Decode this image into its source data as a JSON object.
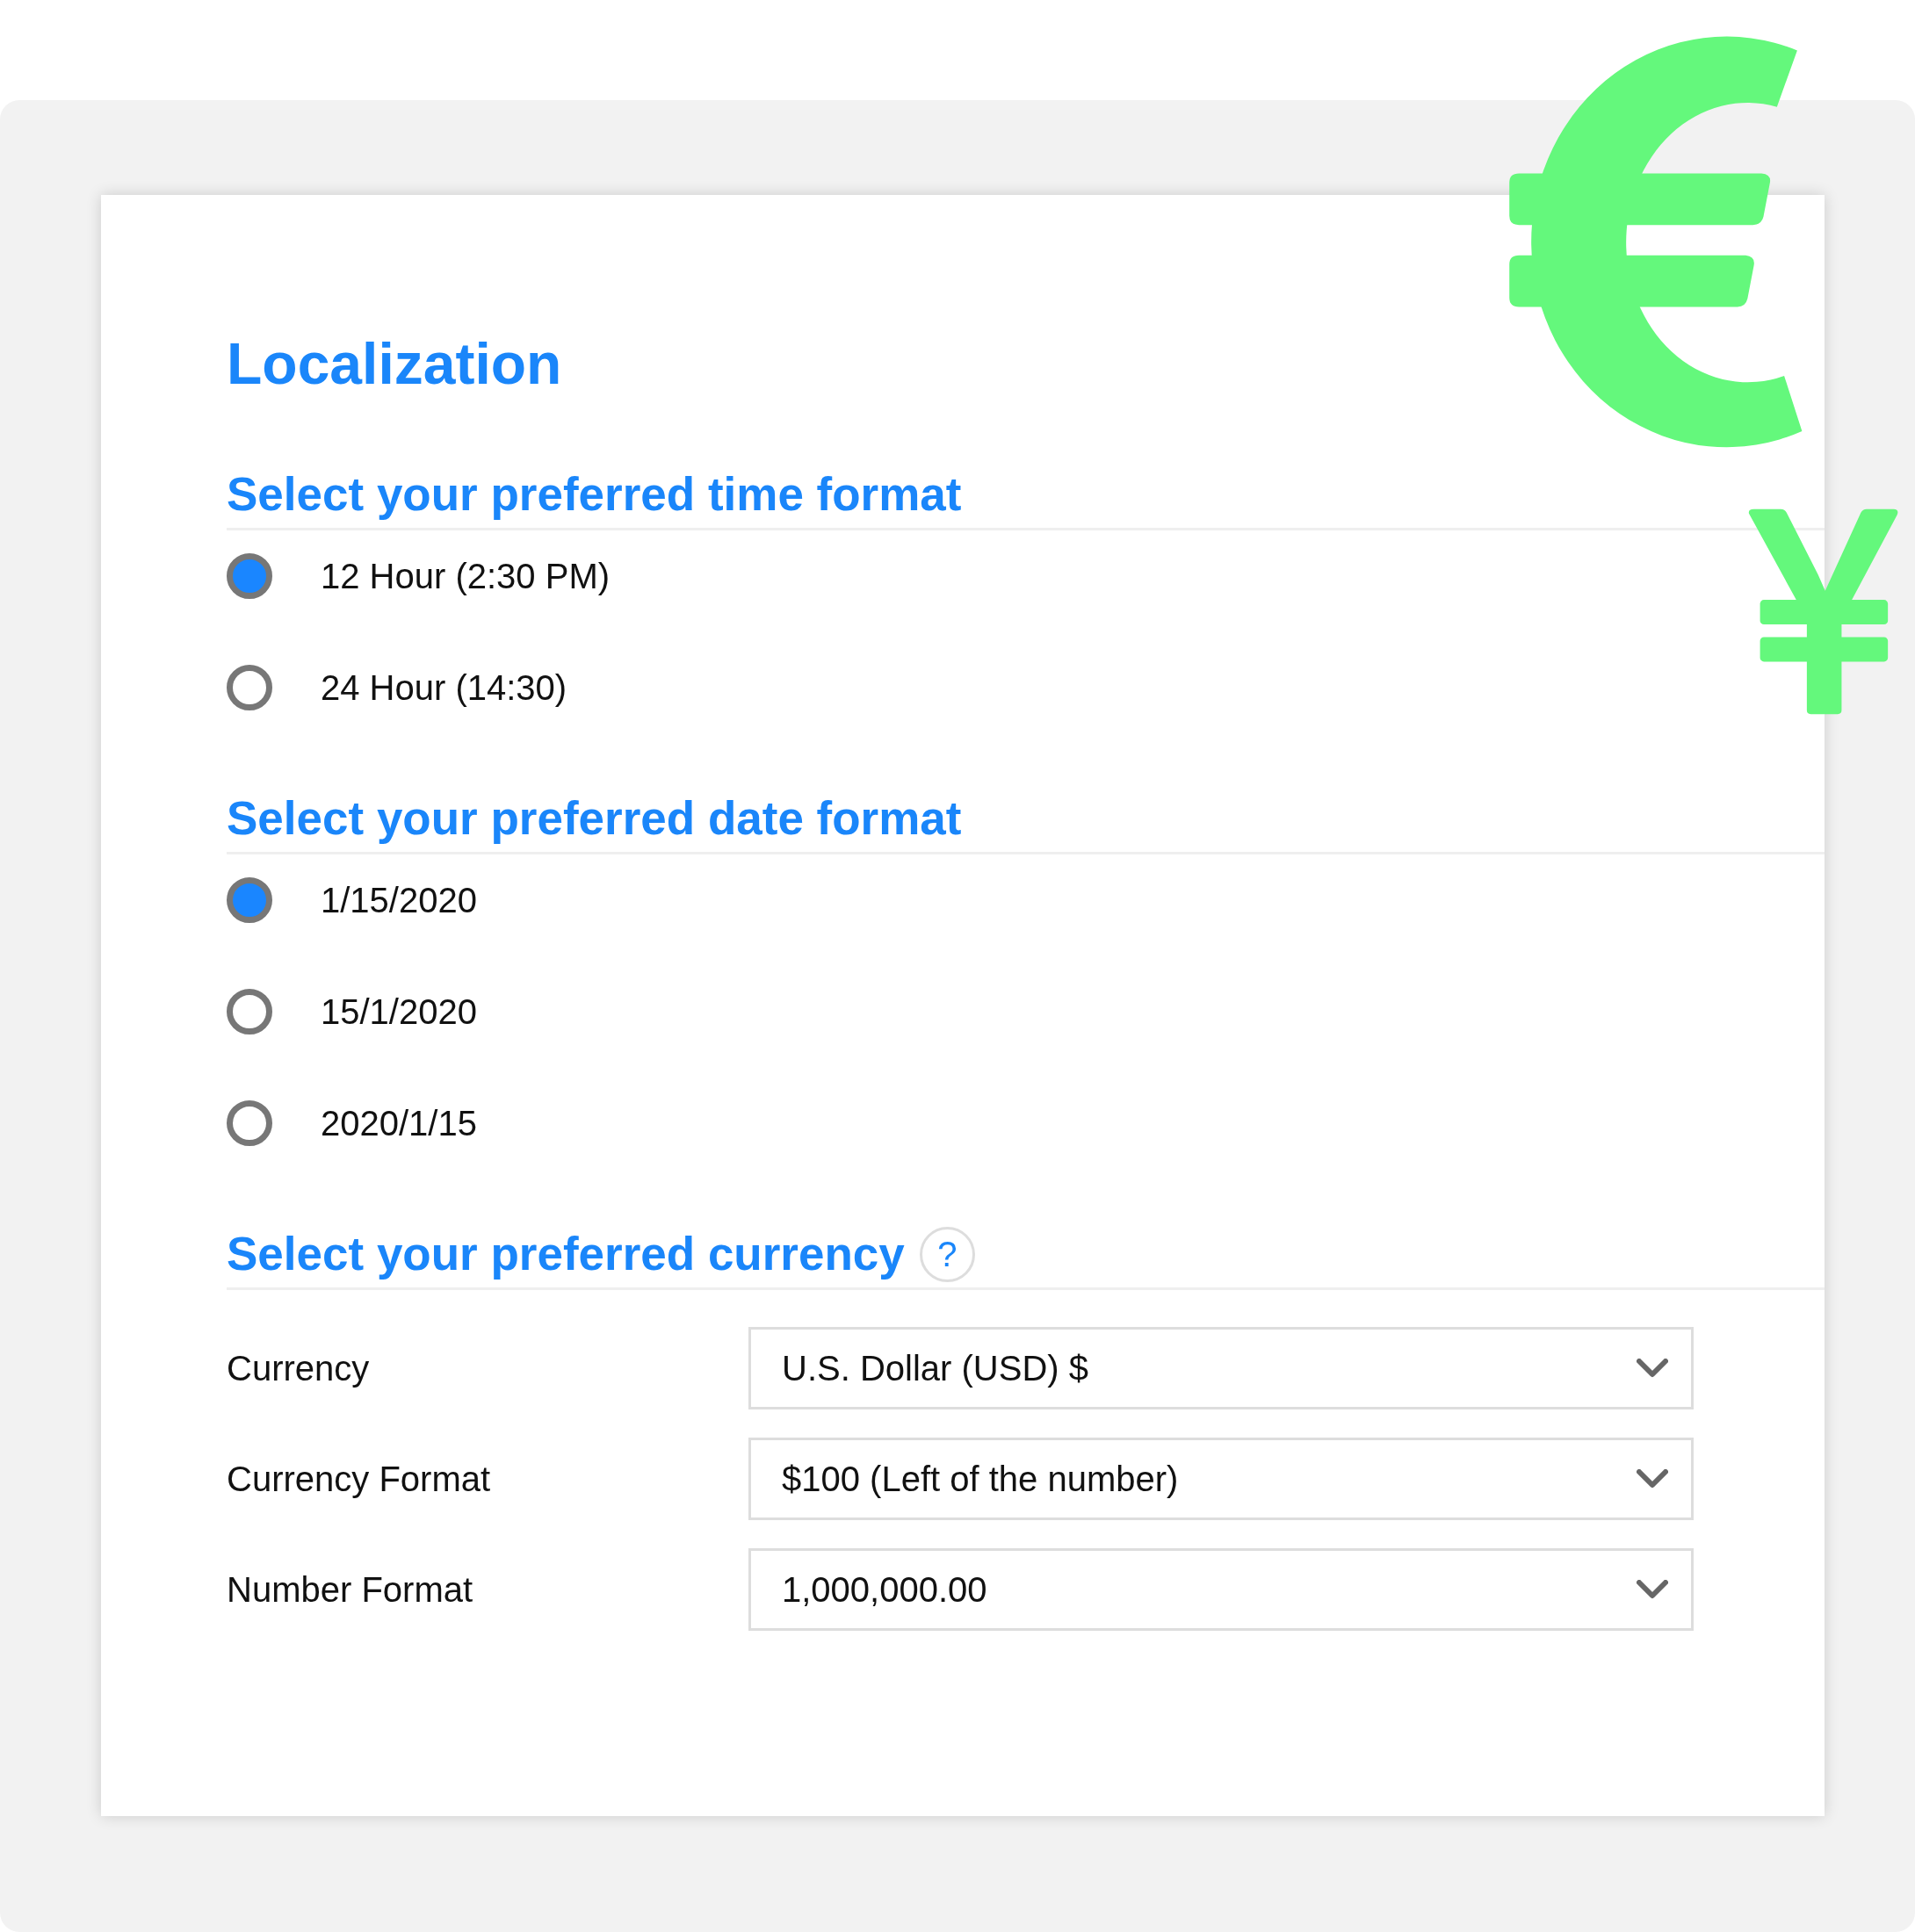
{
  "title": "Localization",
  "sections": [
    {
      "kind": "radio_group",
      "heading": "Select your preferred time format",
      "options": [
        {
          "label": "12 Hour (2:30 PM)",
          "selected": true
        },
        {
          "label": "24 Hour (14:30)",
          "selected": false
        }
      ]
    },
    {
      "kind": "radio_group",
      "heading": "Select your preferred date format",
      "options": [
        {
          "label": "1/15/2020",
          "selected": true
        },
        {
          "label": "15/1/2020",
          "selected": false
        },
        {
          "label": "2020/1/15",
          "selected": false
        }
      ]
    },
    {
      "kind": "dropdowns",
      "heading": "Select your preferred currency",
      "help": "?",
      "fields": [
        {
          "label": "Currency",
          "value": "U.S. Dollar (USD) $"
        },
        {
          "label": "Currency Format",
          "value": "$100 (Left of the number)"
        },
        {
          "label": "Number Format",
          "value": "1,000,000.00"
        }
      ]
    }
  ]
}
